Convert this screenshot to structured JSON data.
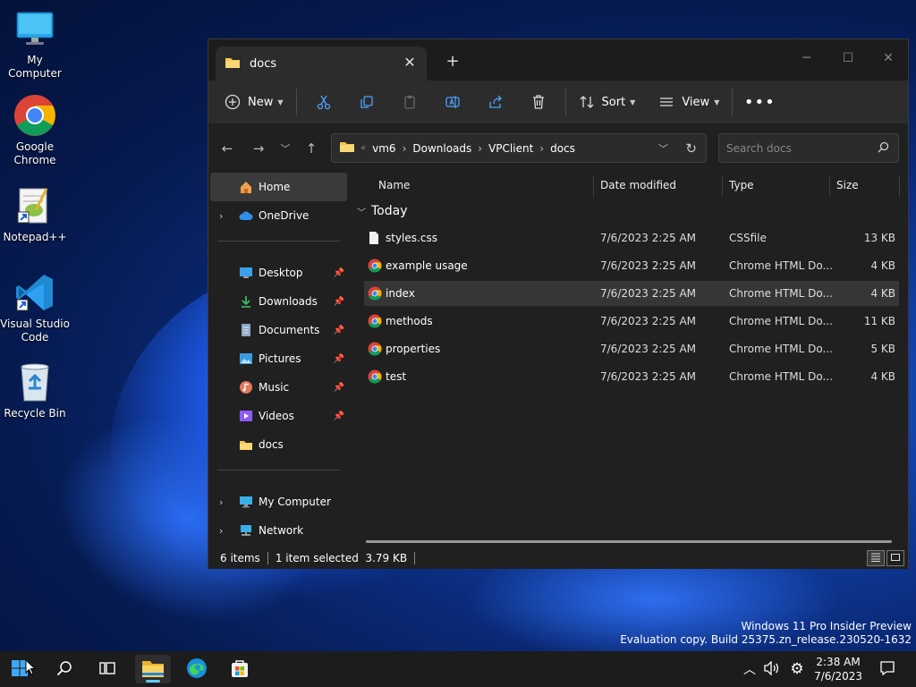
{
  "desktop": {
    "icons": [
      {
        "label": "My Computer",
        "icon": "monitor-icon"
      },
      {
        "label": "Google Chrome",
        "icon": "chrome-icon"
      },
      {
        "label": "Notepad++",
        "icon": "notepadpp-icon"
      },
      {
        "label": "Visual Studio Code",
        "icon": "vscode-icon"
      },
      {
        "label": "Recycle Bin",
        "icon": "recycle-bin-icon"
      }
    ]
  },
  "explorer": {
    "tab_title": "docs",
    "toolbar": {
      "new_label": "New",
      "sort_label": "Sort",
      "view_label": "View"
    },
    "address": {
      "crumbs": [
        "vm6",
        "Downloads",
        "VPClient",
        "docs"
      ]
    },
    "search": {
      "placeholder": "Search docs"
    },
    "nav": {
      "home": "Home",
      "onedrive": "OneDrive",
      "desktop": "Desktop",
      "downloads": "Downloads",
      "documents": "Documents",
      "pictures": "Pictures",
      "music": "Music",
      "videos": "Videos",
      "docs": "docs",
      "my_computer": "My Computer",
      "network": "Network"
    },
    "columns": {
      "name": "Name",
      "date": "Date modified",
      "type": "Type",
      "size": "Size"
    },
    "group_label": "Today",
    "files": [
      {
        "name": "styles.css",
        "date": "7/6/2023 2:25 AM",
        "type": "CSSfile",
        "size": "13 KB",
        "icon": "css-file-icon"
      },
      {
        "name": "example usage",
        "date": "7/6/2023 2:25 AM",
        "type": "Chrome HTML Do...",
        "size": "4 KB",
        "icon": "chrome-icon"
      },
      {
        "name": "index",
        "date": "7/6/2023 2:25 AM",
        "type": "Chrome HTML Do...",
        "size": "4 KB",
        "icon": "chrome-icon",
        "selected": true
      },
      {
        "name": "methods",
        "date": "7/6/2023 2:25 AM",
        "type": "Chrome HTML Do...",
        "size": "11 KB",
        "icon": "chrome-icon"
      },
      {
        "name": "properties",
        "date": "7/6/2023 2:25 AM",
        "type": "Chrome HTML Do...",
        "size": "5 KB",
        "icon": "chrome-icon"
      },
      {
        "name": "test",
        "date": "7/6/2023 2:25 AM",
        "type": "Chrome HTML Do...",
        "size": "4 KB",
        "icon": "chrome-icon"
      }
    ],
    "status": {
      "items": "6 items",
      "selection": "1 item selected  3.79 KB"
    }
  },
  "watermark": {
    "line1": "Windows 11 Pro Insider Preview",
    "line2": "Evaluation copy. Build 25375.zn_release.230520-1632"
  },
  "taskbar": {
    "time": "2:38 AM",
    "date": "7/6/2023"
  },
  "colors": {
    "accent": "#60cdff",
    "folder": "#f3c64b",
    "selection": "#363636"
  }
}
